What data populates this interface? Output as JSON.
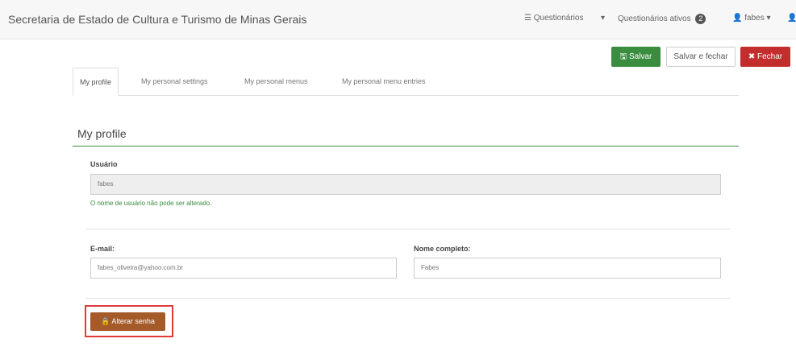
{
  "navbar": {
    "title": "Secretaria de Estado de Cultura e Turismo de Minas Gerais",
    "questionarios_label": "Questionários",
    "questionarios_ativos_label": "Questionários ativos",
    "questionarios_ativos_count": "2",
    "user_label": "fabes"
  },
  "toolbar": {
    "save_label": "Salvar",
    "save_close_label": "Salvar e fechar",
    "close_label": "Fechar"
  },
  "tabs": [
    {
      "label": "My profile",
      "active": true
    },
    {
      "label": "My personal settings",
      "active": false
    },
    {
      "label": "My personal menus",
      "active": false
    },
    {
      "label": "My personal menu entries",
      "active": false
    }
  ],
  "section_title": "My profile",
  "form": {
    "username_label": "Usuário",
    "username_value": "fabes",
    "username_help": "O nome de usuário não pode ser alterado.",
    "email_label": "E-mail:",
    "email_value": "fabes_oliveira@yahoo.com.br",
    "fullname_label": "Nome completo:",
    "fullname_value": "Fabes",
    "change_password_label": "Alterar senha"
  },
  "colors": {
    "primary_green": "#3a8c3f",
    "danger_red": "#c22e2e",
    "warning_brown": "#a55a2a",
    "highlight_red": "#e03a3a"
  },
  "icons": [
    "list-icon",
    "caret-down-icon",
    "user-icon",
    "save-icon",
    "close-icon",
    "lock-icon"
  ]
}
